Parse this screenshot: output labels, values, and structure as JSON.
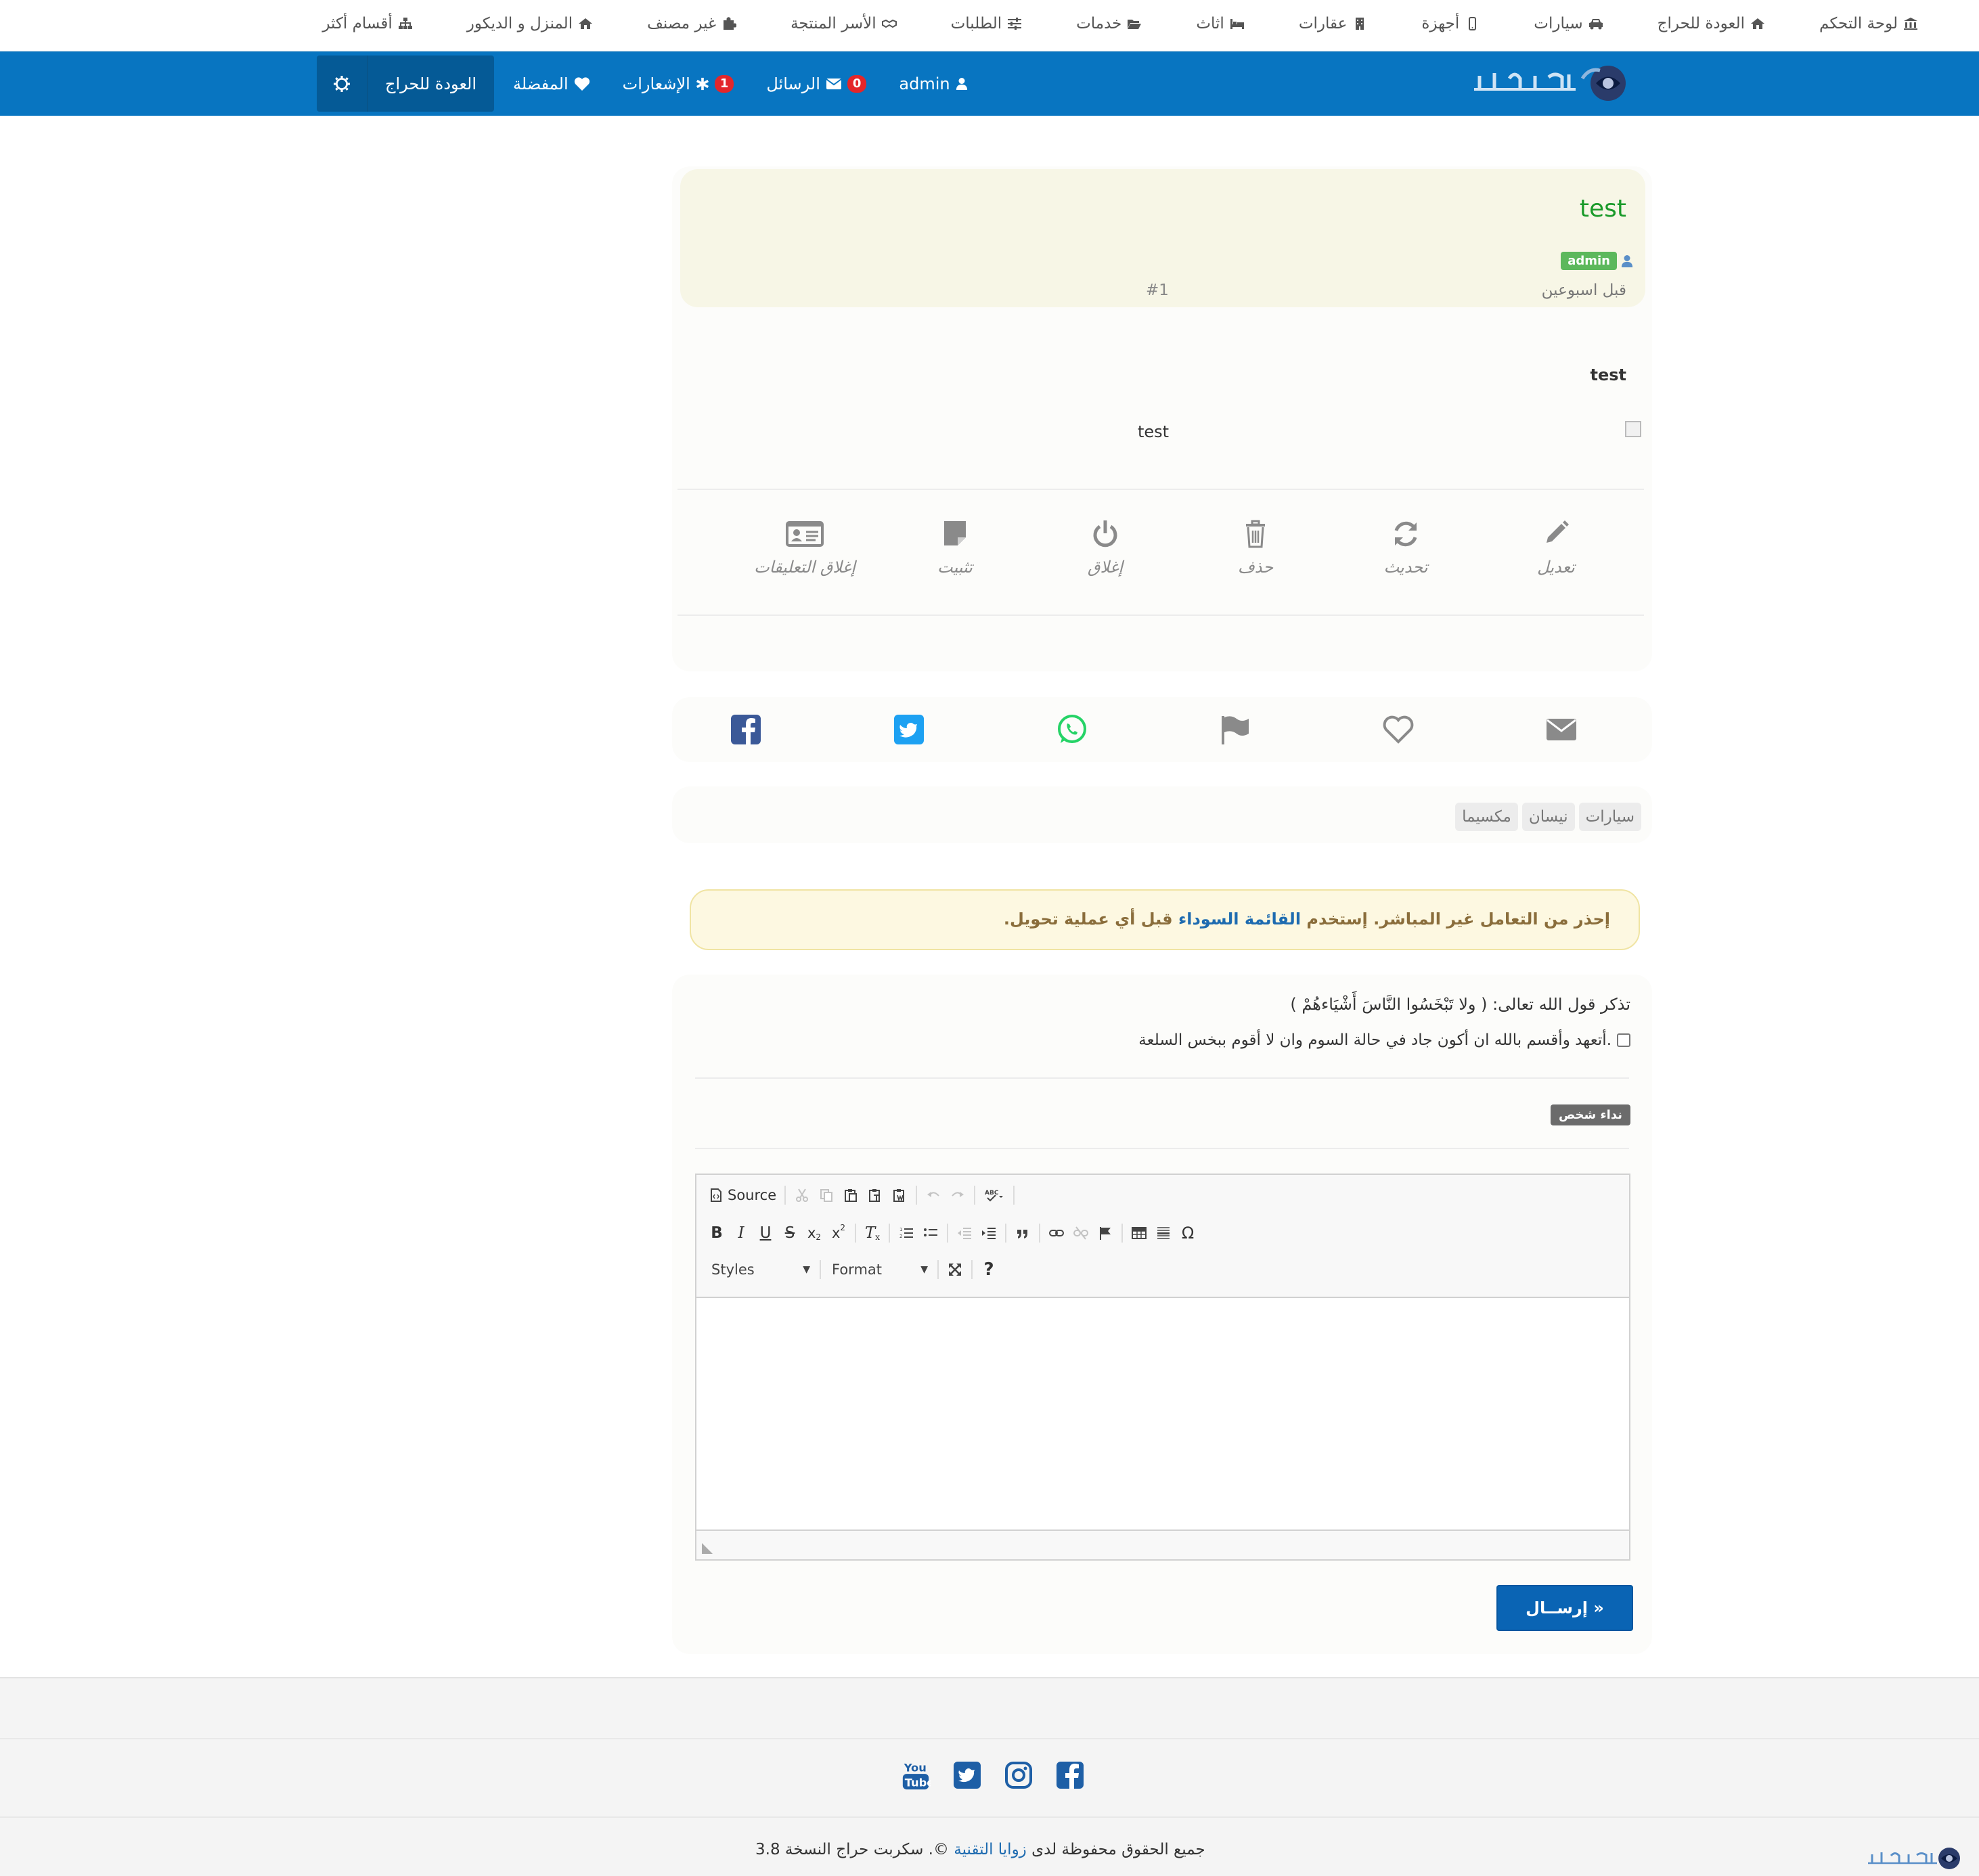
{
  "topnav": {
    "items": [
      {
        "label": "لوحة التحكم",
        "icon": "bank-icon"
      },
      {
        "label": "العودة للحراج",
        "icon": "home-icon"
      },
      {
        "label": "سيارات",
        "icon": "car-icon"
      },
      {
        "label": "أجهزة",
        "icon": "mobile-icon"
      },
      {
        "label": "عقارات",
        "icon": "building-icon"
      },
      {
        "label": "اثاث",
        "icon": "bed-icon"
      },
      {
        "label": "خدمات",
        "icon": "folder-open-icon"
      },
      {
        "label": "الطلبات",
        "icon": "sliders-icon"
      },
      {
        "label": "الأسر المنتجة",
        "icon": "handshake-icon"
      },
      {
        "label": "غير مصنف",
        "icon": "puzzle-icon"
      },
      {
        "label": "المنزل و الديكور",
        "icon": "home-icon"
      },
      {
        "label": "أقسام أكثر",
        "icon": "sitemap-icon"
      }
    ]
  },
  "header": {
    "logo_text": "زوايا التقنية",
    "user": "admin",
    "messages_label": "الرسائل",
    "messages_count": "0",
    "notifications_label": "الإشعارات",
    "notifications_count": "1",
    "favorites_label": "المفضلة",
    "back_label": "العودة للحراج"
  },
  "post": {
    "title": "test",
    "author_badge": "admin",
    "time": "قبل اسبوعين",
    "number": "#1",
    "bold_text": "test",
    "image_alt": "test",
    "actions": [
      {
        "label": "تعديل",
        "icon": "pencil-icon"
      },
      {
        "label": "تحديث",
        "icon": "refresh-icon"
      },
      {
        "label": "حذف",
        "icon": "trash-icon"
      },
      {
        "label": "إغلاق",
        "icon": "power-icon"
      },
      {
        "label": "تثبيت",
        "icon": "sticky-note-icon"
      },
      {
        "label": "إغلاق التعليقات",
        "icon": "id-card-icon"
      }
    ]
  },
  "share": {
    "icons": [
      "envelope-icon",
      "heart-icon",
      "flag-icon",
      "whatsapp-icon",
      "twitter-icon",
      "facebook-icon"
    ]
  },
  "tags": [
    "سيارات",
    "نيسان",
    "مكسيما"
  ],
  "warning": {
    "before": "إحذر من التعامل غير المباشر. إستخدم",
    "link": "القائمة السوداء",
    "after": "قبل أي عملية تحويل."
  },
  "comment": {
    "verse": "تذكر قول الله تعالى: ( ولا تَبْخَسُوا النَّاسَ أَشْيَاءهُمْ )",
    "pledge": "أتعهد وأقسم بالله ان أكون جاد في حالة السوم وان لا أقوم ببخس السلعة.",
    "mention_label": "نداء شخص",
    "editor": {
      "source_label": "Source",
      "styles_label": "Styles",
      "format_label": "Format",
      "help_label": "?"
    },
    "submit_label": "إرســال »"
  },
  "footer": {
    "social": [
      "youtube-icon",
      "twitter-icon",
      "instagram-icon",
      "facebook-icon"
    ],
    "copy_before": "جميع الحقوق محفوظة لدى",
    "copy_link": "زوايا التقنية",
    "copy_after": "©. سكربت حراج النسخة 3.8"
  },
  "colors": {
    "header_blue": "#0875c1",
    "title_green": "#1a9a2a",
    "badge_red": "#e3262a",
    "admin_green": "#5cb85c"
  }
}
